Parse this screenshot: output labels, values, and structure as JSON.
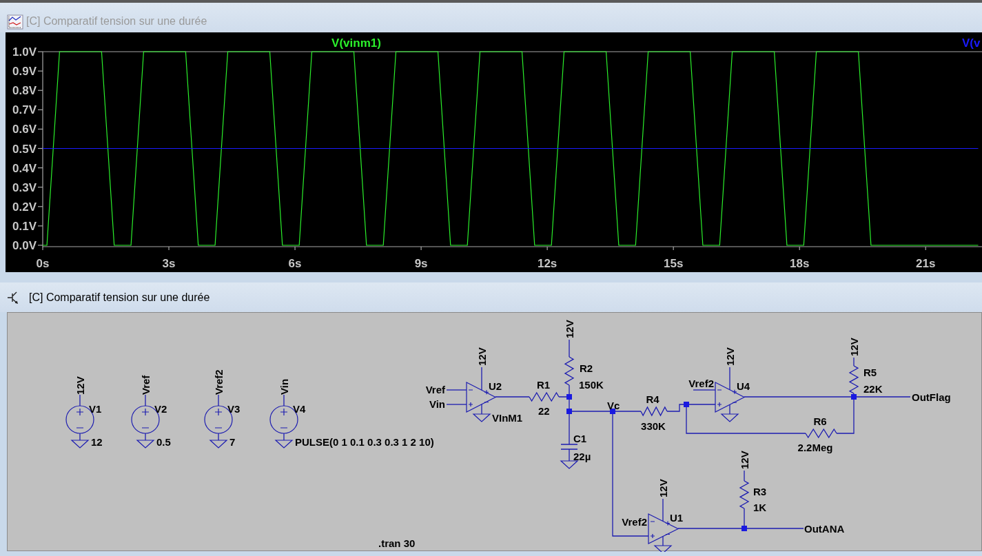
{
  "plot_window": {
    "title": "[C] Comparatif tension sur une durée",
    "active": false,
    "chart_data": {
      "type": "line",
      "x": [
        0,
        0.1,
        0.4,
        1.4,
        1.7,
        2.1,
        2.4,
        3.4,
        3.7,
        4.1,
        4.4,
        5.4,
        5.7,
        6.1,
        6.4,
        7.4,
        7.7,
        8.1,
        8.4,
        9.4,
        9.7,
        10.1,
        10.4,
        11.4,
        11.7,
        12.1,
        12.4,
        13.4,
        13.7,
        14.1,
        14.4,
        15.4,
        15.7,
        16.1,
        16.4,
        17.4,
        17.7,
        18.1,
        18.4,
        19.4,
        19.7,
        22.25
      ],
      "series": [
        {
          "name": "V(vinm1)",
          "color": "#2bf02b",
          "values": [
            0,
            0,
            1,
            1,
            0,
            0,
            1,
            1,
            0,
            0,
            1,
            1,
            0,
            0,
            1,
            1,
            0,
            0,
            1,
            1,
            0,
            0,
            1,
            1,
            0,
            0,
            1,
            1,
            0,
            0,
            1,
            1,
            0,
            0,
            1,
            1,
            0,
            0,
            1,
            1,
            0,
            0
          ]
        },
        {
          "name": "V(v",
          "color": "#1a1aff",
          "values": [
            0.5,
            0.5,
            0.5,
            0.5,
            0.5,
            0.5,
            0.5,
            0.5,
            0.5,
            0.5,
            0.5,
            0.5,
            0.5,
            0.5,
            0.5,
            0.5,
            0.5,
            0.5,
            0.5,
            0.5,
            0.5,
            0.5,
            0.5,
            0.5,
            0.5,
            0.5,
            0.5,
            0.5,
            0.5,
            0.5,
            0.5,
            0.5,
            0.5,
            0.5,
            0.5,
            0.5,
            0.5,
            0.5,
            0.5,
            0.5,
            0.5,
            0.5
          ]
        }
      ],
      "xlim": [
        0,
        22.34
      ],
      "ylim": [
        0,
        1
      ],
      "xticks": [
        {
          "value": 0,
          "label": "0s"
        },
        {
          "value": 3,
          "label": "3s"
        },
        {
          "value": 6,
          "label": "6s"
        },
        {
          "value": 9,
          "label": "9s"
        },
        {
          "value": 12,
          "label": "12s"
        },
        {
          "value": 15,
          "label": "15s"
        },
        {
          "value": 18,
          "label": "18s"
        },
        {
          "value": 21,
          "label": "21s"
        }
      ],
      "yticks": [
        {
          "value": 0,
          "label": "0.0V"
        },
        {
          "value": 0.1,
          "label": "0.1V"
        },
        {
          "value": 0.2,
          "label": "0.2V"
        },
        {
          "value": 0.3,
          "label": "0.3V"
        },
        {
          "value": 0.4,
          "label": "0.4V"
        },
        {
          "value": 0.5,
          "label": "0.5V"
        },
        {
          "value": 0.6,
          "label": "0.6V"
        },
        {
          "value": 0.7,
          "label": "0.7V"
        },
        {
          "value": 0.8,
          "label": "0.8V"
        },
        {
          "value": 0.9,
          "label": "0.9V"
        },
        {
          "value": 1,
          "label": "1.0V"
        }
      ]
    }
  },
  "schematic_window": {
    "title": "[C] Comparatif tension sur une durée",
    "active": true,
    "sources": [
      {
        "ref": "V1",
        "net": "12V",
        "value": "12"
      },
      {
        "ref": "V2",
        "net": "Vref",
        "value": "0.5"
      },
      {
        "ref": "V3",
        "net": "Vref2",
        "value": "7"
      },
      {
        "ref": "V4",
        "net": "Vin",
        "value": "PULSE(0 1 0.1 0.3 0.3 1 2 10)"
      }
    ],
    "opamps": [
      {
        "ref": "U2",
        "supply": "12V",
        "input_labels": [
          "Vref",
          "Vin"
        ],
        "output_label": "VInM1"
      },
      {
        "ref": "U4",
        "supply": "12V",
        "input_labels": [
          "Vref2"
        ]
      },
      {
        "ref": "U1",
        "supply": "12V",
        "input_labels": [
          "Vref2"
        ]
      }
    ],
    "resistors": [
      {
        "ref": "R1",
        "value": "22"
      },
      {
        "ref": "R2",
        "value": "150K",
        "supply": "12V"
      },
      {
        "ref": "R4",
        "value": "330K"
      },
      {
        "ref": "R5",
        "value": "22K",
        "supply": "12V"
      },
      {
        "ref": "R6",
        "value": "2.2Meg"
      },
      {
        "ref": "R3",
        "value": "1K",
        "supply": "12V"
      }
    ],
    "capacitors": [
      {
        "ref": "C1",
        "value": "22µ"
      }
    ],
    "net_labels": [
      "Vc",
      "OutFlag",
      "OutANA"
    ],
    "directive": ".tran 30"
  }
}
